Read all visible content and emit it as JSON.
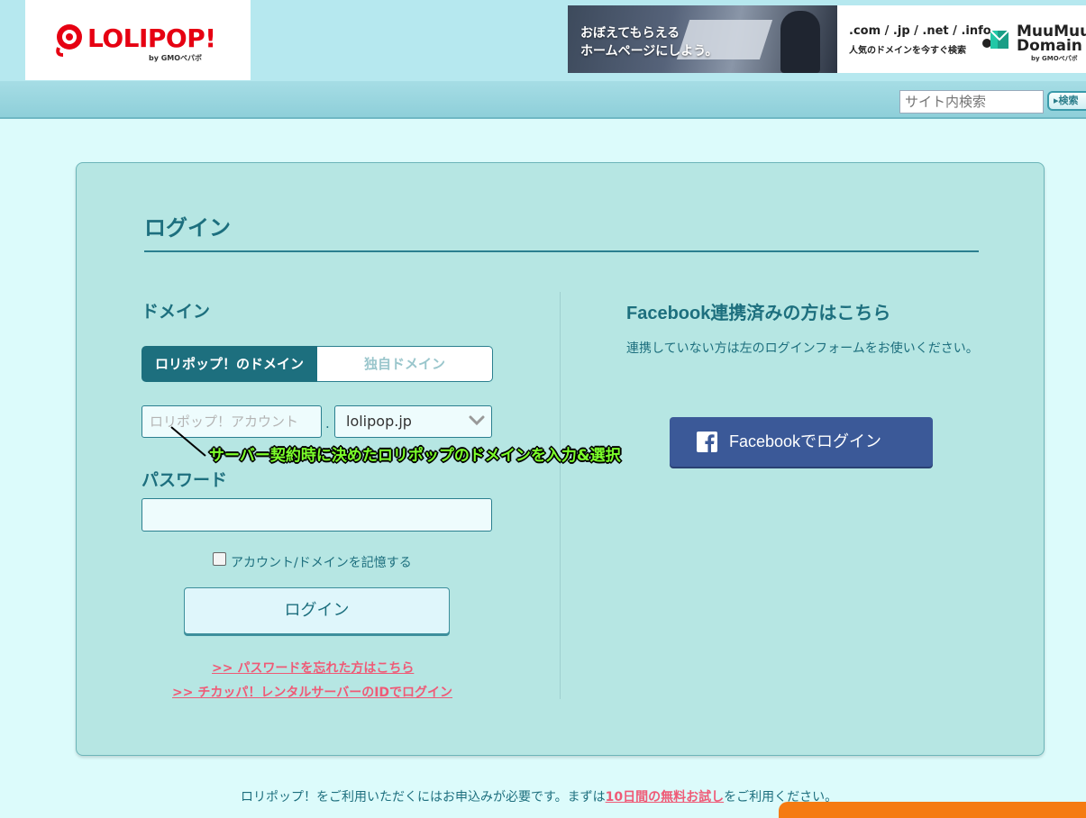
{
  "header": {
    "logo_text": "LOLIPOP!",
    "logo_byline": "by GMOペパボ",
    "banner": {
      "line1": "おぼえてもらえる",
      "line2": "ホームページにしよう。",
      "domains": ".com / .jp / .net / .info",
      "domains_sub": "人気のドメインを今すぐ検索",
      "brand_line1": "MuuMuu",
      "brand_line2": "Domain",
      "brand_byline": "by GMOペパボ"
    },
    "search": {
      "placeholder": "サイト内検索",
      "button_label": "▸検索"
    }
  },
  "login": {
    "title": "ログイン",
    "domain_label": "ドメイン",
    "tabs": [
      "ロリポップ！のドメイン",
      "独自ドメイン"
    ],
    "active_tab": "ロリポップ！のドメイン",
    "account_placeholder": "ロリポップ！アカウント",
    "separator": ".",
    "domain_selected": "lolipop.jp",
    "password_label": "パスワード",
    "password_value": "",
    "remember_label": "アカウント/ドメインを記憶する",
    "remember_checked": false,
    "submit_label": "ログイン",
    "links": [
      ">>  パスワードを忘れた方はこちら",
      ">>  チカッパ！レンタルサーバーのIDでログイン"
    ]
  },
  "annotation": "サーバー契約時に決めたロリポップのドメインを入力&選択",
  "facebook": {
    "title": "Facebook連携済みの方はこちら",
    "note": "連携していない方は左のログインフォームをお使いください。",
    "button_label": "Facebookでログイン",
    "icon": "facebook-f-icon"
  },
  "footer": {
    "note_before": "ロリポップ！をご利用いただくにはお申込みが必要です。まずは",
    "note_link": "10日間の無料お試し",
    "note_after": "をご利用ください。"
  },
  "colors": {
    "accent": "#1d6f7e",
    "link": "#ef5a76",
    "facebook": "#3b5998",
    "card_bg": "#b6e6e3",
    "page_bg": "#dcfbfb",
    "annotation": "#7CFF2A",
    "logo_red": "#e60012"
  }
}
